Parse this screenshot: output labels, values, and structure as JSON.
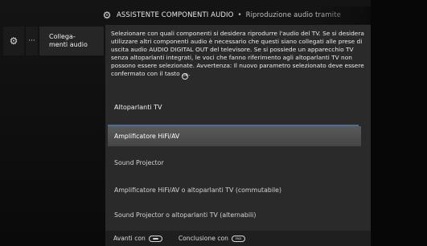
{
  "title": {
    "main": "ASSISTENTE COMPONENTI AUDIO",
    "sub": "Riproduzione audio tramite"
  },
  "left_menu": {
    "label": "Collega-\nmenti audio"
  },
  "description": {
    "text": "Selezionare con quali componenti si desidera riprodurre l'audio del TV. Se si desidera utilizzare altri componenti audio è necessario che questi siano collegati alle prese di uscita audio AUDIO DIGITAL OUT del televisore. Se si possiede un apparecchio TV senza altoparlanti integrati, le voci che fanno riferimento agli altoparlanti TV non possono essere selezionate. Avvertenza: Il nuovo parametro selezionato deve essere confermato con il tasto",
    "ok_key": "OK"
  },
  "options": {
    "header": "Altoparlanti TV",
    "items": [
      "Amplificatore HiFi/AV",
      "Sound Projector",
      "Amplificatore HiFi/AV o altoparlanti TV (commutabile)",
      "Sound Projector o altoparlanti TV (alternabili)"
    ]
  },
  "footer": {
    "next_label": "Avanti con",
    "end_label": "Conclusione con",
    "end_key": "END"
  },
  "colors": {
    "panel": "#2a2a2a",
    "selected": "#505050",
    "accent_line": "#4a6f94"
  }
}
